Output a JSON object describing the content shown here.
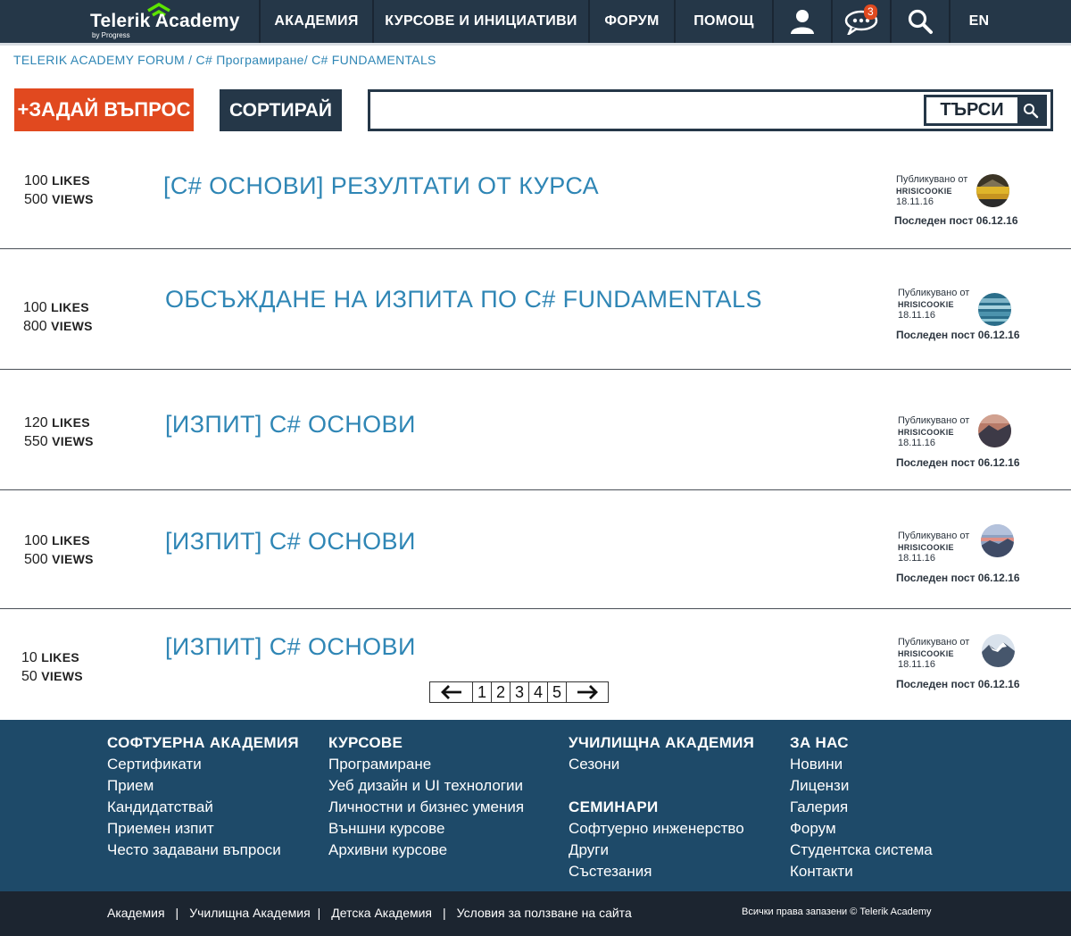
{
  "header": {
    "logo_name": "Telerik Academy",
    "logo_by": "by Progress",
    "nav": [
      "АКАДЕМИЯ",
      "КУРСОВЕ И ИНИЦИАТИВИ",
      "ФОРУМ",
      "ПОМОЩ"
    ],
    "notifications_count": "3",
    "lang": "EN",
    "icons": [
      "user-icon",
      "chat-icon",
      "search-icon"
    ]
  },
  "breadcrumb": {
    "forum": "TELERIK ACADEMY FORUM",
    "sep1": " / ",
    "category": "C# Програмиране",
    "sep2": "/ ",
    "subcategory": "C# FUNDAMENTALS"
  },
  "toolbar": {
    "ask_label": "+ЗАДАЙ ВЪПРОС",
    "sort_label": "СОРТИРАЙ",
    "search_value": "",
    "search_label": "ТЪРСИ"
  },
  "topics": [
    {
      "likes": "100",
      "views": "500",
      "likes_unit": "LIKES",
      "views_unit": "VIEWS",
      "title": "[C# ОСНОВИ] РЕЗУЛТАТИ ОТ КУРСА",
      "published_label": "Публикувано от",
      "author": "HRISICOOKIE",
      "date": "18.11.16",
      "last_post": "Последен пост 06.12.16"
    },
    {
      "likes": "100",
      "views": "800",
      "likes_unit": "LIKES",
      "views_unit": "VIEWS",
      "title": "ОБСЪЖДАНЕ НА ИЗПИТА ПО C# FUNDAMENTALS",
      "published_label": "Публикувано от",
      "author": "HRISICOOKIE",
      "date": "18.11.16",
      "last_post": "Последен пост 06.12.16"
    },
    {
      "likes": "120",
      "views": "550",
      "likes_unit": "LIKES",
      "views_unit": "VIEWS",
      "title": "[ИЗПИТ] C# ОСНОВИ",
      "published_label": "Публикувано от",
      "author": "HRISICOOKIE",
      "date": "18.11.16",
      "last_post": "Последен пост 06.12.16"
    },
    {
      "likes": "100",
      "views": "500",
      "likes_unit": "LIKES",
      "views_unit": "VIEWS",
      "title": "[ИЗПИТ] C# ОСНОВИ",
      "published_label": "Публикувано от",
      "author": "HRISICOOKIE",
      "date": "18.11.16",
      "last_post": "Последен пост 06.12.16"
    },
    {
      "likes": "10",
      "views": "50",
      "likes_unit": "LIKES",
      "views_unit": "VIEWS",
      "title": "[ИЗПИТ] C# ОСНОВИ",
      "published_label": "Публикувано от",
      "author": "HRISICOOKIE",
      "date": "18.11.16",
      "last_post": "Последен пост 06.12.16"
    }
  ],
  "pagination": {
    "pages": [
      "1",
      "2",
      "3",
      "4",
      "5"
    ]
  },
  "footer": {
    "columns": [
      {
        "head": "СОФТУЕРНА АКАДЕМИЯ",
        "links": [
          "Сертификати",
          "Прием",
          "Кандидатствай",
          "Приемен изпит",
          "Често задавани въпроси"
        ]
      },
      {
        "head": "КУРСОВЕ",
        "links": [
          "Програмиране",
          "Уеб дизайн и UI технологии",
          "Личностни и бизнес умения",
          "Външни курсове",
          "Архивни курсове"
        ]
      },
      {
        "head": "УЧИЛИЩНА АКАДЕМИЯ",
        "links": [
          "Сезони"
        ],
        "head2": "СЕМИНАРИ",
        "links2": [
          "Софтуерно инженерство",
          "Други",
          "Състезания"
        ]
      },
      {
        "head": "ЗА НАС",
        "links": [
          "Новини",
          "Лицензи",
          "Галерия",
          "Форум",
          "Студентска система",
          "Контакти"
        ]
      }
    ],
    "bottom_links": [
      "Академия",
      "Училищна Академия",
      "Детска Академия",
      "Условия за ползване на сайта"
    ],
    "bottom_sep": "|",
    "copyright": "Всички права запазени  ©  Telerik Academy"
  },
  "colors": {
    "header_bg": "#253748",
    "accent_orange": "#e1491f",
    "link_blue": "#2f86b5",
    "footer_bg": "#1e4a69",
    "footer_bottom_bg": "#1c2530",
    "logo_green": "#5ce500"
  }
}
